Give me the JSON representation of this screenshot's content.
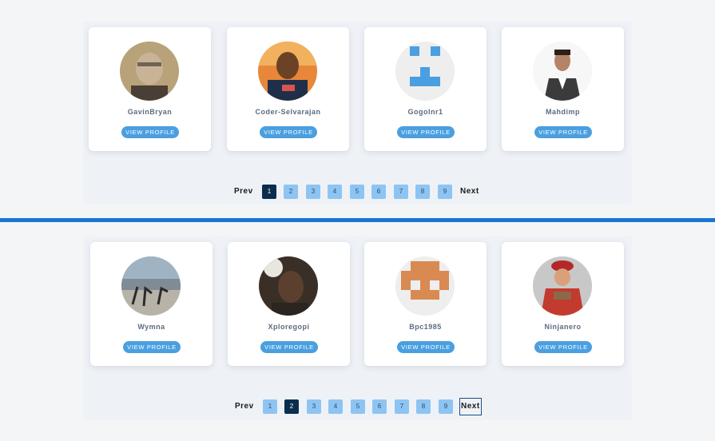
{
  "top": {
    "cards": [
      {
        "username": "GavinBryan",
        "button": "VIEW PROFILE"
      },
      {
        "username": "Coder-Selvarajan",
        "button": "VIEW PROFILE"
      },
      {
        "username": "Gogolnr1",
        "button": "VIEW PROFILE"
      },
      {
        "username": "Mahdimp",
        "button": "VIEW PROFILE"
      }
    ],
    "pagination": {
      "prev": "Prev",
      "next": "Next",
      "pages": [
        "1",
        "2",
        "3",
        "4",
        "5",
        "6",
        "7",
        "8",
        "9"
      ],
      "current": "1"
    }
  },
  "bottom": {
    "cards": [
      {
        "username": "Wymna",
        "button": "VIEW PROFILE"
      },
      {
        "username": "Xploregopi",
        "button": "VIEW PROFILE"
      },
      {
        "username": "Bpc1985",
        "button": "VIEW PROFILE"
      },
      {
        "username": "Ninjanero",
        "button": "VIEW PROFILE"
      }
    ],
    "pagination": {
      "prev": "Prev",
      "next": "Next",
      "pages": [
        "1",
        "2",
        "3",
        "4",
        "5",
        "6",
        "7",
        "8",
        "9"
      ],
      "current": "2"
    }
  },
  "colors": {
    "accent": "#4a9fe0",
    "divider": "#1976d2",
    "page_active": "#0b2d4e",
    "page_inactive": "#8ec4f2"
  }
}
